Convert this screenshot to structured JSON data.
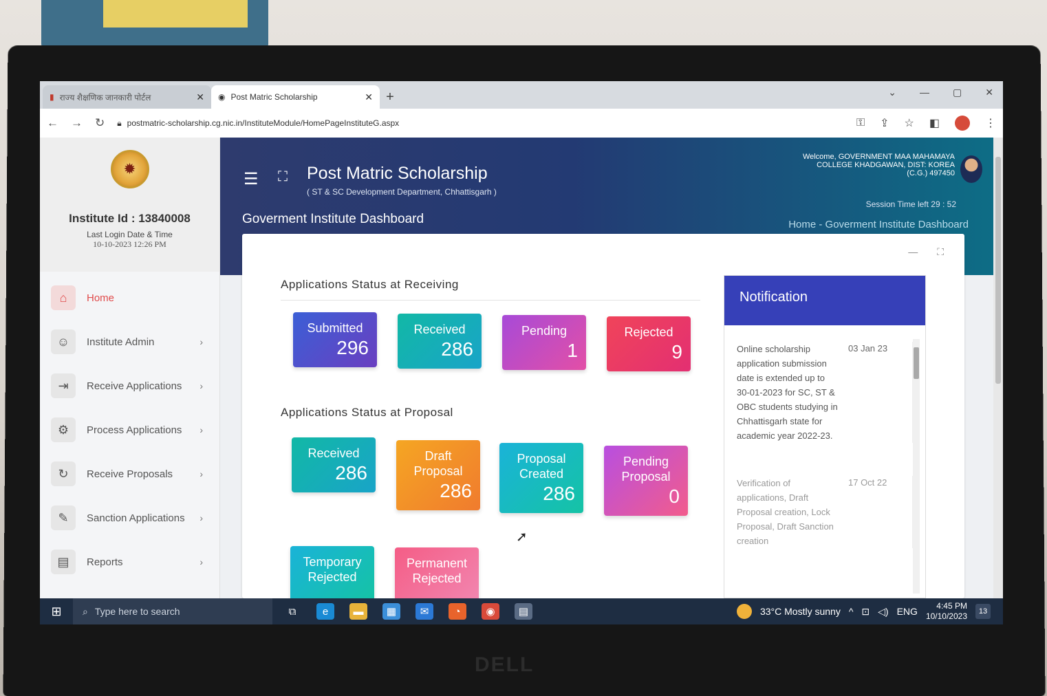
{
  "browser": {
    "tabs": [
      {
        "title": "राज्य शैक्षणिक जानकारी पोर्टल",
        "active": false
      },
      {
        "title": "Post Matric Scholarship",
        "active": true
      }
    ],
    "url": "postmatric-scholarship.cg.nic.in/InstituteModule/HomePageInstituteG.aspx"
  },
  "sidebar": {
    "institute_id": "Institute Id : 13840008",
    "last_login_label": "Last Login Date & Time",
    "last_login_value": "10-10-2023 12:26 PM",
    "items": [
      {
        "label": "Home",
        "icon": "home-icon",
        "active": true
      },
      {
        "label": "Institute Admin",
        "icon": "user-icon",
        "chevron": "›"
      },
      {
        "label": "Receive Applications",
        "icon": "login-icon",
        "chevron": "›"
      },
      {
        "label": "Process Applications",
        "icon": "settings-icon",
        "chevron": "›"
      },
      {
        "label": "Receive Proposals",
        "icon": "refresh-icon",
        "chevron": "›"
      },
      {
        "label": "Sanction Applications",
        "icon": "edit-icon",
        "chevron": "›"
      },
      {
        "label": "Reports",
        "icon": "document-icon",
        "chevron": "›"
      }
    ]
  },
  "header": {
    "title": "Post Matric Scholarship",
    "subtitle": "( ST & SC Development Department, Chhattisgarh )",
    "welcome": "Welcome, GOVERNMENT MAA MAHAMAYA COLLEGE KHADGAWAN, DIST: KOREA (C.G.) 497450",
    "session": "Session Time left 29 : 52",
    "dashboard_title": "Goverment Institute Dashboard",
    "breadcrumb_home": "Home",
    "breadcrumb_sep": "-",
    "breadcrumb_current": "Goverment Institute Dashboard"
  },
  "receiving": {
    "heading": "Applications Status at Receiving",
    "tiles": [
      {
        "label": "Submitted",
        "value": "296",
        "color": "#3b5fd6"
      },
      {
        "label": "Received",
        "value": "286",
        "color": "#12b8a6"
      },
      {
        "label": "Pending",
        "value": "1",
        "color": "#a74ad8"
      },
      {
        "label": "Rejected",
        "value": "9",
        "color": "#f0445a"
      }
    ]
  },
  "proposal": {
    "heading": "Applications Status at Proposal",
    "tiles": [
      {
        "label": "Received",
        "value": "286",
        "color": "#12b8a6"
      },
      {
        "label": "Draft Proposal",
        "value": "286",
        "color": "#f5a623"
      },
      {
        "label": "Proposal Created",
        "value": "286",
        "color": "#1ab3d8"
      },
      {
        "label": "Pending Proposal",
        "value": "0",
        "color": "#b84fe0"
      }
    ],
    "tiles_bottom": [
      {
        "label": "Temporary Rejected",
        "color": "#1ab3d8"
      },
      {
        "label": "Permanent Rejected",
        "color": "#f45d86"
      }
    ]
  },
  "notification": {
    "title": "Notification",
    "items": [
      {
        "text": "Online scholarship application submission date is extended up to 30-01-2023 for SC, ST & OBC students studying in Chhattisgarh state for academic year 2022-23.",
        "date": "03 Jan 23"
      },
      {
        "text": "Verification of applications, Draft Proposal creation, Lock Proposal, Draft Sanction creation",
        "date": "17 Oct 22"
      }
    ]
  },
  "taskbar": {
    "search_placeholder": "Type here to search",
    "weather": "33°C  Mostly sunny",
    "lang": "ENG",
    "time": "4:45 PM",
    "date": "10/10/2023",
    "notif_count": "13"
  }
}
